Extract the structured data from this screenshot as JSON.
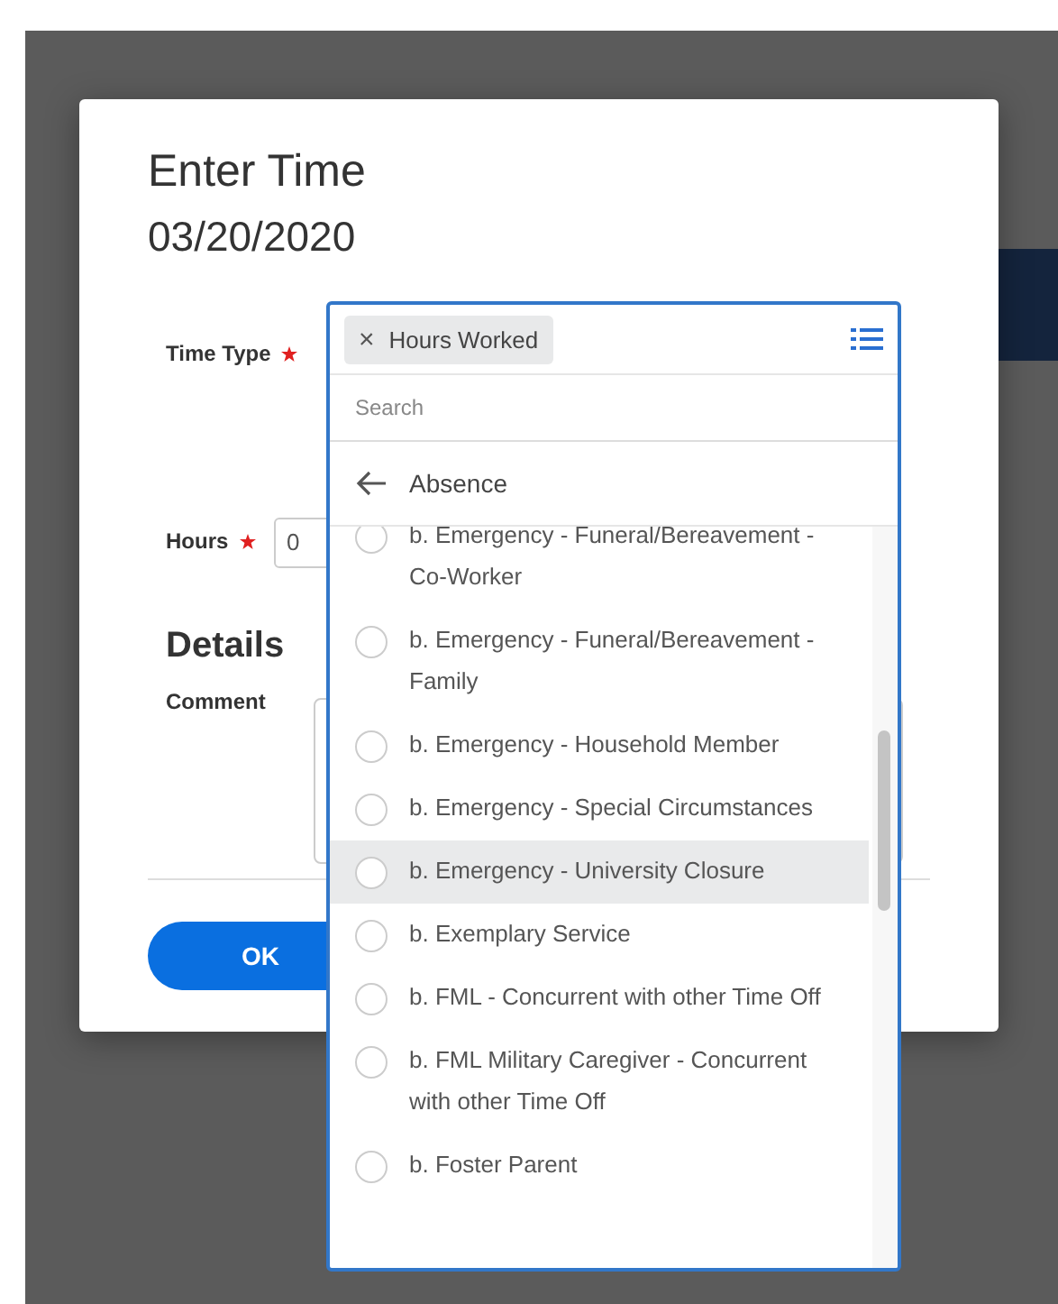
{
  "dialog": {
    "title": "Enter Time",
    "date": "03/20/2020",
    "fields": [
      {
        "label": "Time Type",
        "required": true
      },
      {
        "label": "Hours",
        "required": true,
        "value": "0"
      }
    ],
    "section": "Details",
    "comment_label": "Comment",
    "ok_button": "OK"
  },
  "dropdown": {
    "chip": "Hours Worked",
    "chip_remove": "×",
    "search": {
      "placeholder": "Search"
    },
    "category": "Absence",
    "items": [
      {
        "label": "b. Emergency - Funeral/Bereavement - Co-Worker",
        "selected": false,
        "highlighted": false
      },
      {
        "label": "b. Emergency - Funeral/Bereavement - Family",
        "selected": false,
        "highlighted": false
      },
      {
        "label": "b. Emergency - Household Member",
        "selected": false,
        "highlighted": false
      },
      {
        "label": "b. Emergency - Special Circumstances",
        "selected": false,
        "highlighted": false
      },
      {
        "label": "b. Emergency - University Closure",
        "selected": false,
        "highlighted": true
      },
      {
        "label": "b. Exemplary Service",
        "selected": false,
        "highlighted": false
      },
      {
        "label": "b. FML - Concurrent with other Time Off",
        "selected": false,
        "highlighted": false
      },
      {
        "label": "b. FML Military Caregiver - Concurrent with other Time Off",
        "selected": false,
        "highlighted": false
      },
      {
        "label": "b. Foster Parent",
        "selected": false,
        "highlighted": false
      }
    ]
  }
}
